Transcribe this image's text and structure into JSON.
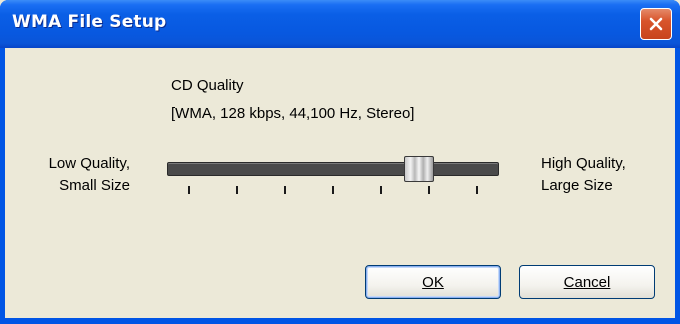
{
  "window": {
    "title": "WMA File Setup"
  },
  "quality": {
    "name": "CD Quality",
    "description": "[WMA, 128 kbps, 44,100 Hz, Stereo]",
    "low_label_line1": "Low Quality,",
    "low_label_line2": "Small Size",
    "high_label_line1": "High Quality,",
    "high_label_line2": "Large Size",
    "slider_value_fraction": 0.8,
    "tick_count": 7
  },
  "buttons": {
    "ok_label": "OK",
    "cancel_label": "Cancel"
  },
  "icons": {
    "close": "close-icon"
  },
  "colors": {
    "titlebar": "#0a5ee8",
    "close_button": "#d8542b",
    "dialog_background": "#ece9d8",
    "button_border": "#003c74"
  }
}
